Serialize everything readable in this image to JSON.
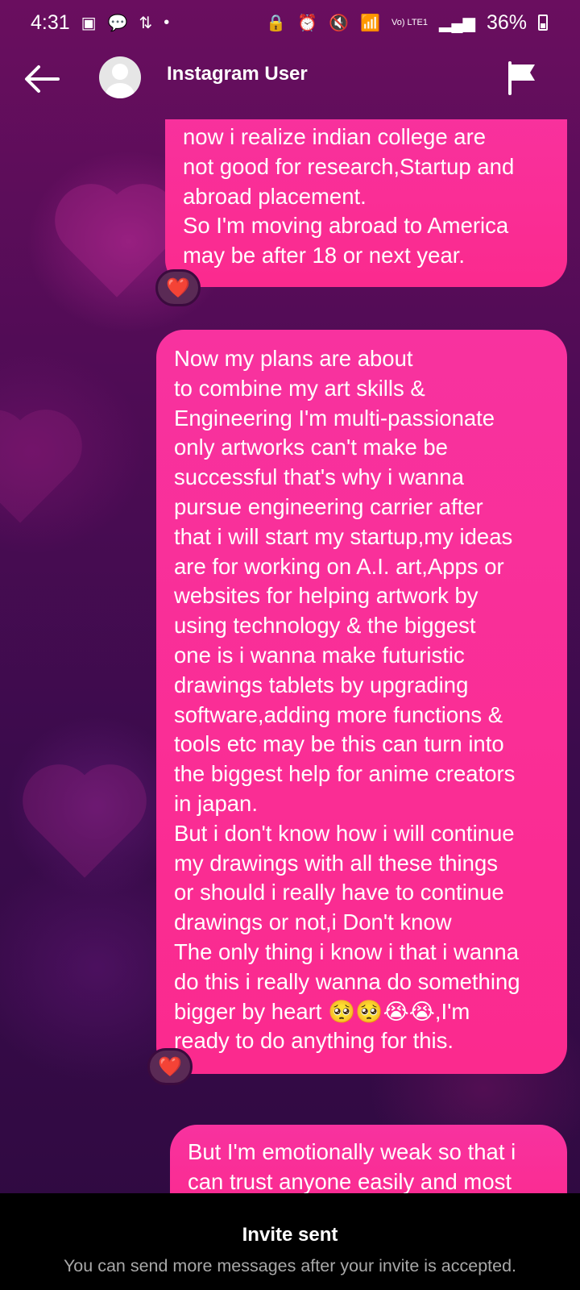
{
  "status_bar": {
    "time": "4:31",
    "network": "Vo) LTE1",
    "battery": "36%"
  },
  "header": {
    "title": "Instagram User"
  },
  "messages": [
    {
      "text": "now i realize indian college are\nnot good for research,Startup and\nabroad placement.\nSo I'm moving abroad to America\nmay be after 18 or next year.",
      "reaction": "❤️"
    },
    {
      "text": "Now my plans are about\nto combine my art skills &\nEngineering I'm multi-passionate\nonly artworks can't make be\nsuccessful that's why i wanna\npursue engineering carrier after\nthat i will start my startup,my ideas\nare for working on A.I. art,Apps or\nwebsites for helping artwork by\nusing technology & the biggest\none is i wanna make futuristic\ndrawings tablets by upgrading\nsoftware,adding more functions &\ntools etc may be this can turn into\nthe biggest help for anime creators\nin japan.\nBut i don't know how i will continue\nmy drawings with all these things\nor should i really have to continue\ndrawings or not,i Don't know\nThe only thing i know i that i wanna\ndo this i really wanna do something\nbigger by heart 🥺🥺😭😭,I'm\nready to do anything for this.",
      "reaction": "❤️"
    },
    {
      "text": "But I'm emotionally weak so that i\ncan trust anyone easily and most"
    }
  ],
  "footer": {
    "title": "Invite sent",
    "subtitle": "You can send more messages after your invite is accepted."
  }
}
